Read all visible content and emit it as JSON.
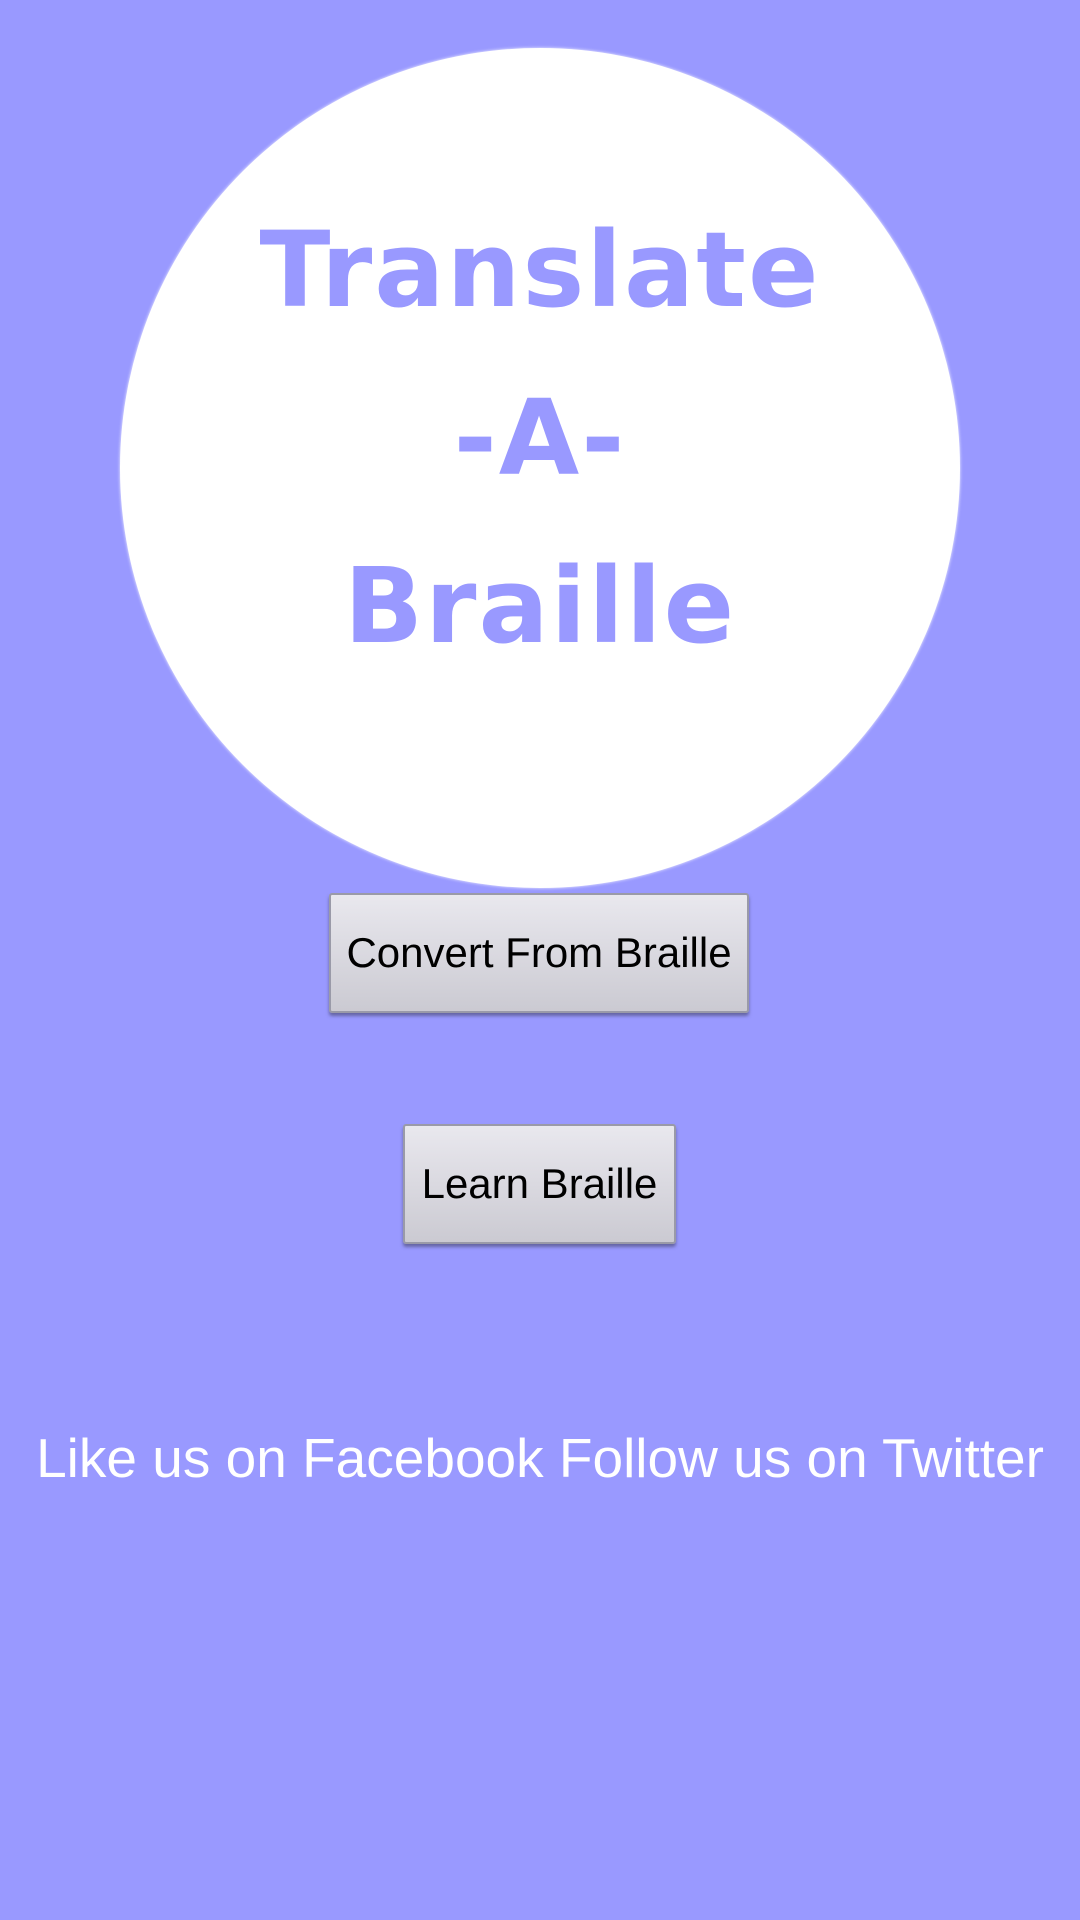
{
  "logo": {
    "line1": "Translate",
    "line2": "-A-",
    "line3": "Braille"
  },
  "buttons": {
    "convert_label": "Convert From Braille",
    "learn_label": "Learn Braille"
  },
  "social": {
    "facebook_label": "Like us on Facebook",
    "twitter_label": "Follow us on Twitter"
  },
  "colors": {
    "background": "#9999ff",
    "logo_circle": "#ffffff",
    "logo_text": "#9999ff",
    "button_text": "#000000",
    "link_text": "#ffffff"
  }
}
